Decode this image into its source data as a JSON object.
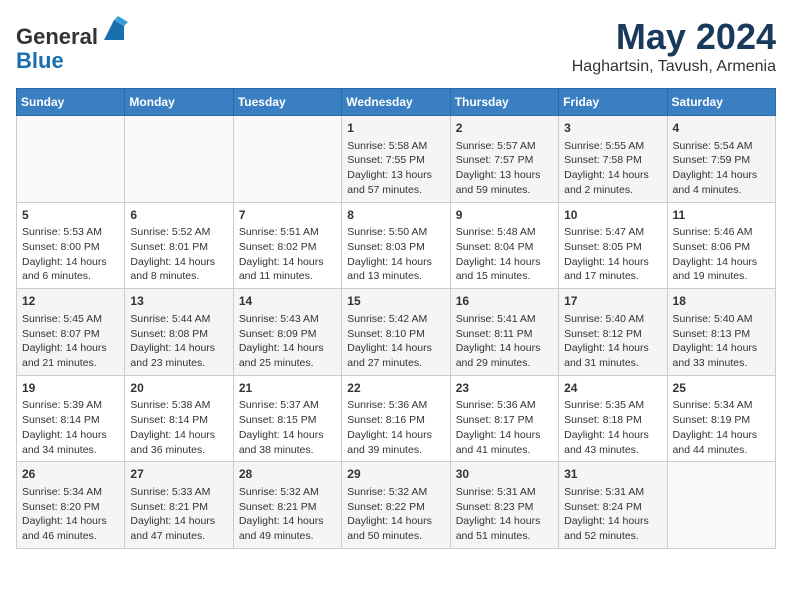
{
  "header": {
    "logo_line1": "General",
    "logo_line2": "Blue",
    "month": "May 2024",
    "location": "Haghartsin, Tavush, Armenia"
  },
  "weekdays": [
    "Sunday",
    "Monday",
    "Tuesday",
    "Wednesday",
    "Thursday",
    "Friday",
    "Saturday"
  ],
  "weeks": [
    [
      {
        "day": "",
        "sunrise": "",
        "sunset": "",
        "daylight": ""
      },
      {
        "day": "",
        "sunrise": "",
        "sunset": "",
        "daylight": ""
      },
      {
        "day": "",
        "sunrise": "",
        "sunset": "",
        "daylight": ""
      },
      {
        "day": "1",
        "sunrise": "Sunrise: 5:58 AM",
        "sunset": "Sunset: 7:55 PM",
        "daylight": "Daylight: 13 hours and 57 minutes."
      },
      {
        "day": "2",
        "sunrise": "Sunrise: 5:57 AM",
        "sunset": "Sunset: 7:57 PM",
        "daylight": "Daylight: 13 hours and 59 minutes."
      },
      {
        "day": "3",
        "sunrise": "Sunrise: 5:55 AM",
        "sunset": "Sunset: 7:58 PM",
        "daylight": "Daylight: 14 hours and 2 minutes."
      },
      {
        "day": "4",
        "sunrise": "Sunrise: 5:54 AM",
        "sunset": "Sunset: 7:59 PM",
        "daylight": "Daylight: 14 hours and 4 minutes."
      }
    ],
    [
      {
        "day": "5",
        "sunrise": "Sunrise: 5:53 AM",
        "sunset": "Sunset: 8:00 PM",
        "daylight": "Daylight: 14 hours and 6 minutes."
      },
      {
        "day": "6",
        "sunrise": "Sunrise: 5:52 AM",
        "sunset": "Sunset: 8:01 PM",
        "daylight": "Daylight: 14 hours and 8 minutes."
      },
      {
        "day": "7",
        "sunrise": "Sunrise: 5:51 AM",
        "sunset": "Sunset: 8:02 PM",
        "daylight": "Daylight: 14 hours and 11 minutes."
      },
      {
        "day": "8",
        "sunrise": "Sunrise: 5:50 AM",
        "sunset": "Sunset: 8:03 PM",
        "daylight": "Daylight: 14 hours and 13 minutes."
      },
      {
        "day": "9",
        "sunrise": "Sunrise: 5:48 AM",
        "sunset": "Sunset: 8:04 PM",
        "daylight": "Daylight: 14 hours and 15 minutes."
      },
      {
        "day": "10",
        "sunrise": "Sunrise: 5:47 AM",
        "sunset": "Sunset: 8:05 PM",
        "daylight": "Daylight: 14 hours and 17 minutes."
      },
      {
        "day": "11",
        "sunrise": "Sunrise: 5:46 AM",
        "sunset": "Sunset: 8:06 PM",
        "daylight": "Daylight: 14 hours and 19 minutes."
      }
    ],
    [
      {
        "day": "12",
        "sunrise": "Sunrise: 5:45 AM",
        "sunset": "Sunset: 8:07 PM",
        "daylight": "Daylight: 14 hours and 21 minutes."
      },
      {
        "day": "13",
        "sunrise": "Sunrise: 5:44 AM",
        "sunset": "Sunset: 8:08 PM",
        "daylight": "Daylight: 14 hours and 23 minutes."
      },
      {
        "day": "14",
        "sunrise": "Sunrise: 5:43 AM",
        "sunset": "Sunset: 8:09 PM",
        "daylight": "Daylight: 14 hours and 25 minutes."
      },
      {
        "day": "15",
        "sunrise": "Sunrise: 5:42 AM",
        "sunset": "Sunset: 8:10 PM",
        "daylight": "Daylight: 14 hours and 27 minutes."
      },
      {
        "day": "16",
        "sunrise": "Sunrise: 5:41 AM",
        "sunset": "Sunset: 8:11 PM",
        "daylight": "Daylight: 14 hours and 29 minutes."
      },
      {
        "day": "17",
        "sunrise": "Sunrise: 5:40 AM",
        "sunset": "Sunset: 8:12 PM",
        "daylight": "Daylight: 14 hours and 31 minutes."
      },
      {
        "day": "18",
        "sunrise": "Sunrise: 5:40 AM",
        "sunset": "Sunset: 8:13 PM",
        "daylight": "Daylight: 14 hours and 33 minutes."
      }
    ],
    [
      {
        "day": "19",
        "sunrise": "Sunrise: 5:39 AM",
        "sunset": "Sunset: 8:14 PM",
        "daylight": "Daylight: 14 hours and 34 minutes."
      },
      {
        "day": "20",
        "sunrise": "Sunrise: 5:38 AM",
        "sunset": "Sunset: 8:14 PM",
        "daylight": "Daylight: 14 hours and 36 minutes."
      },
      {
        "day": "21",
        "sunrise": "Sunrise: 5:37 AM",
        "sunset": "Sunset: 8:15 PM",
        "daylight": "Daylight: 14 hours and 38 minutes."
      },
      {
        "day": "22",
        "sunrise": "Sunrise: 5:36 AM",
        "sunset": "Sunset: 8:16 PM",
        "daylight": "Daylight: 14 hours and 39 minutes."
      },
      {
        "day": "23",
        "sunrise": "Sunrise: 5:36 AM",
        "sunset": "Sunset: 8:17 PM",
        "daylight": "Daylight: 14 hours and 41 minutes."
      },
      {
        "day": "24",
        "sunrise": "Sunrise: 5:35 AM",
        "sunset": "Sunset: 8:18 PM",
        "daylight": "Daylight: 14 hours and 43 minutes."
      },
      {
        "day": "25",
        "sunrise": "Sunrise: 5:34 AM",
        "sunset": "Sunset: 8:19 PM",
        "daylight": "Daylight: 14 hours and 44 minutes."
      }
    ],
    [
      {
        "day": "26",
        "sunrise": "Sunrise: 5:34 AM",
        "sunset": "Sunset: 8:20 PM",
        "daylight": "Daylight: 14 hours and 46 minutes."
      },
      {
        "day": "27",
        "sunrise": "Sunrise: 5:33 AM",
        "sunset": "Sunset: 8:21 PM",
        "daylight": "Daylight: 14 hours and 47 minutes."
      },
      {
        "day": "28",
        "sunrise": "Sunrise: 5:32 AM",
        "sunset": "Sunset: 8:21 PM",
        "daylight": "Daylight: 14 hours and 49 minutes."
      },
      {
        "day": "29",
        "sunrise": "Sunrise: 5:32 AM",
        "sunset": "Sunset: 8:22 PM",
        "daylight": "Daylight: 14 hours and 50 minutes."
      },
      {
        "day": "30",
        "sunrise": "Sunrise: 5:31 AM",
        "sunset": "Sunset: 8:23 PM",
        "daylight": "Daylight: 14 hours and 51 minutes."
      },
      {
        "day": "31",
        "sunrise": "Sunrise: 5:31 AM",
        "sunset": "Sunset: 8:24 PM",
        "daylight": "Daylight: 14 hours and 52 minutes."
      },
      {
        "day": "",
        "sunrise": "",
        "sunset": "",
        "daylight": ""
      }
    ]
  ]
}
